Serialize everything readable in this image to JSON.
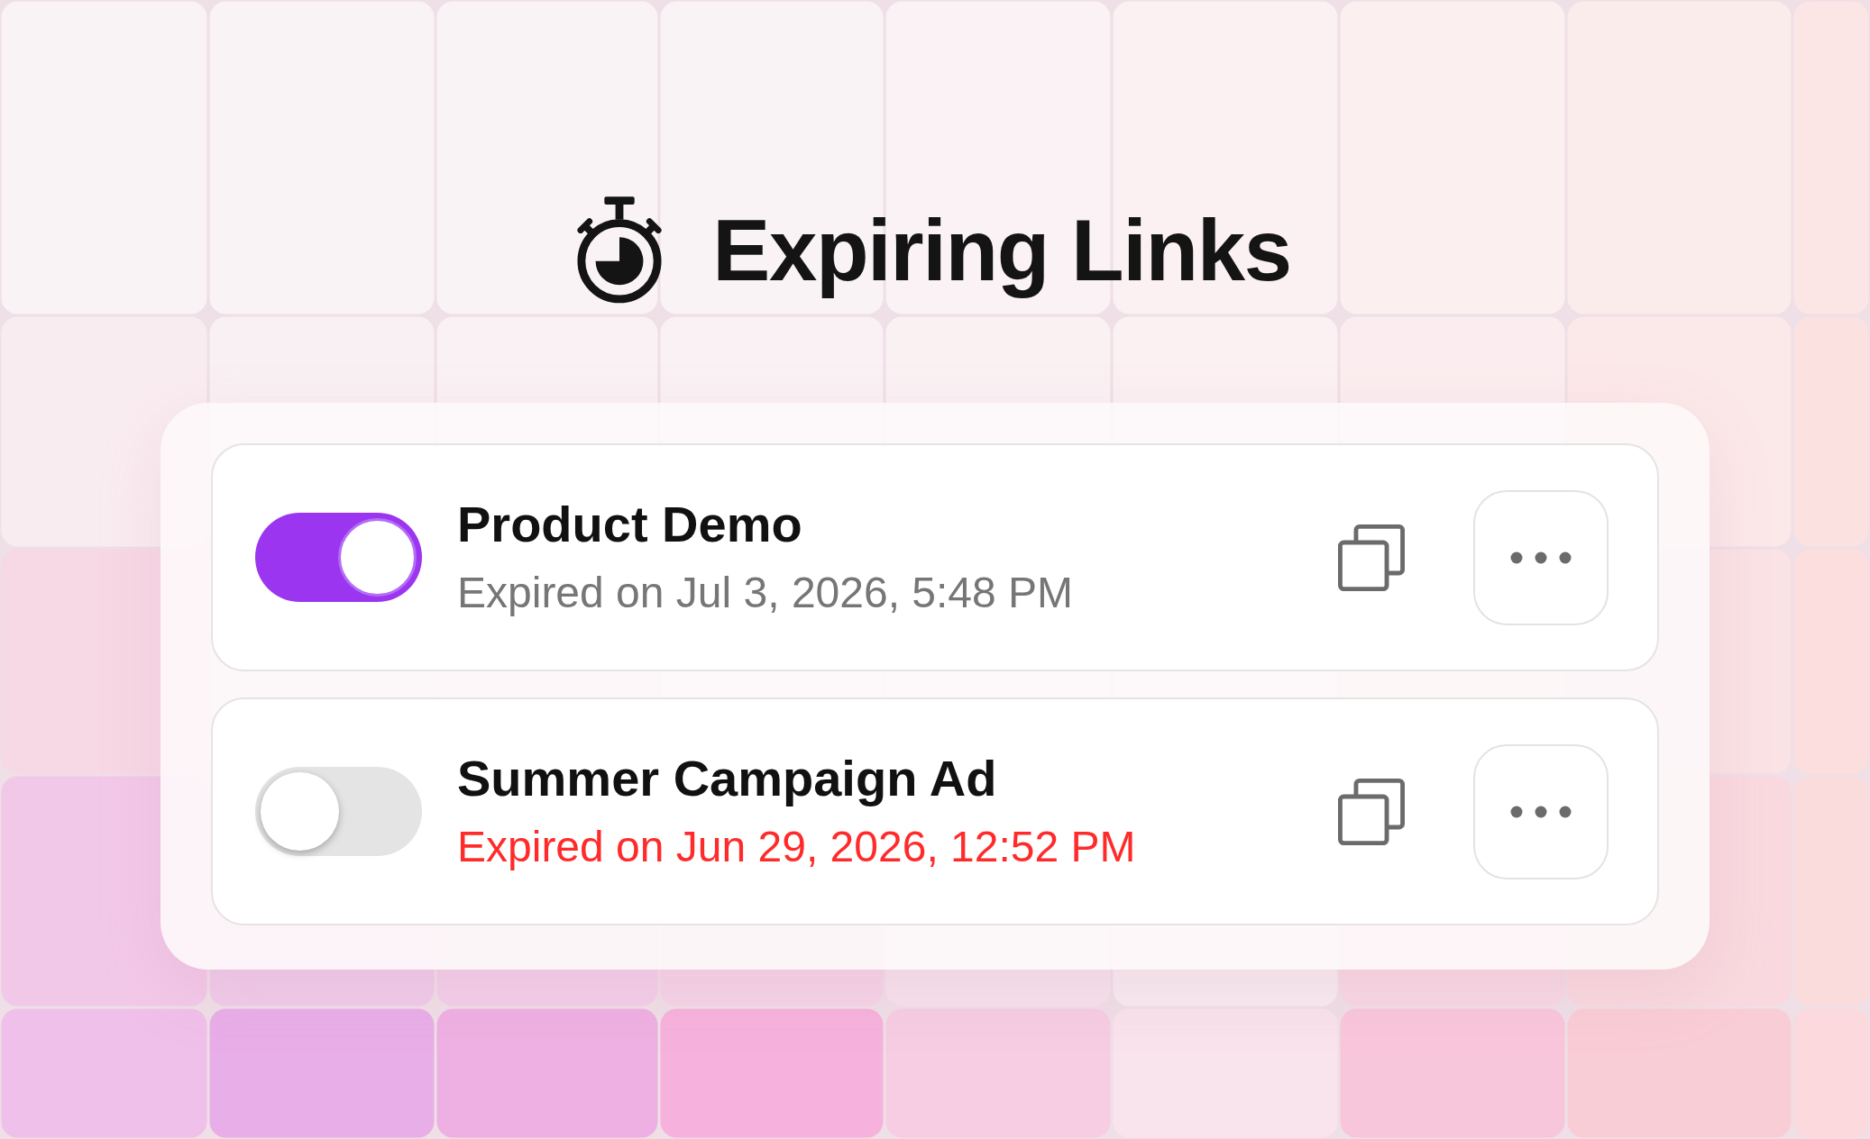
{
  "title": "Expiring Links",
  "links": [
    {
      "name": "Product Demo",
      "expiry": "Expired on Jul 3, 2026, 5:48 PM",
      "color": "#767676",
      "on": true
    },
    {
      "name": "Summer Campaign Ad",
      "expiry": "Expired on Jun 29, 2026, 12:52 PM",
      "color": "#ff2b2b",
      "on": false
    }
  ]
}
